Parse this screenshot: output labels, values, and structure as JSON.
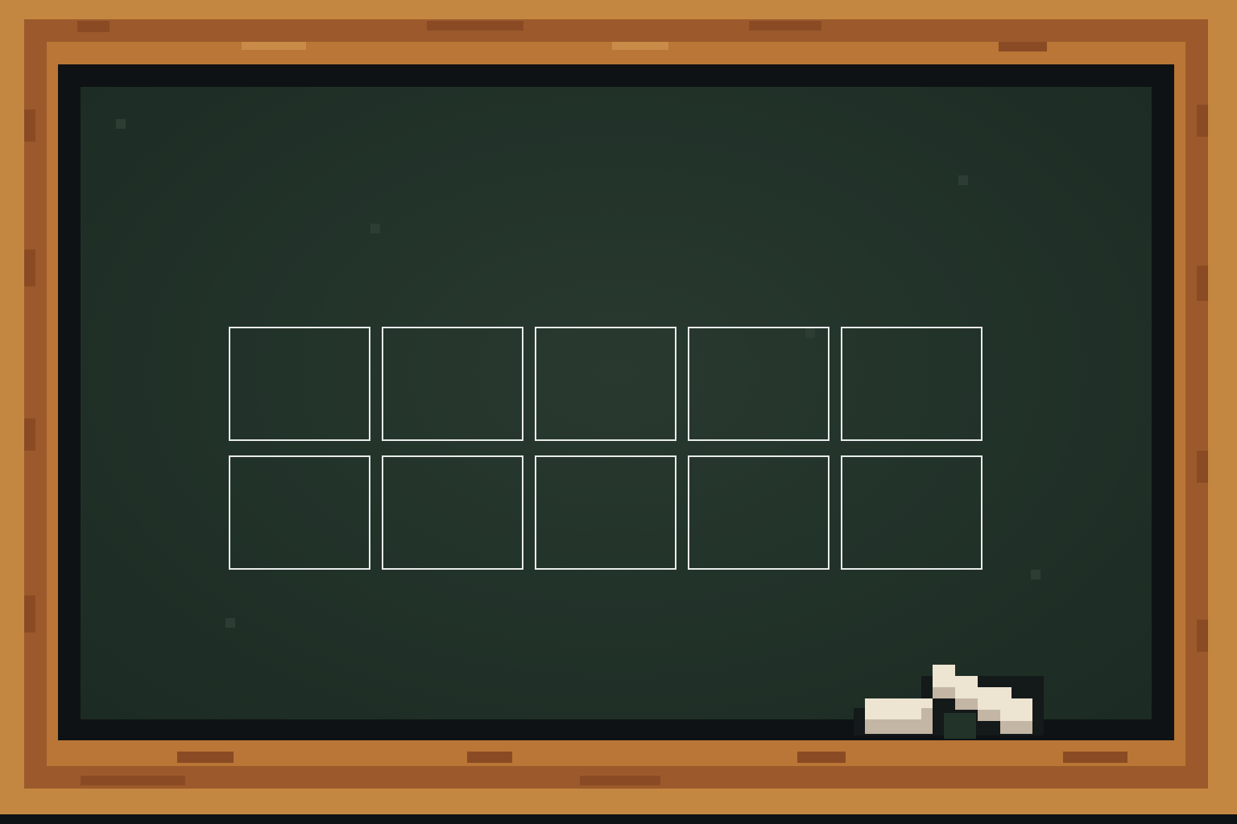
{
  "scene": {
    "type": "chalkboard-slot-grid",
    "colors": {
      "frame_light": "#c48741",
      "frame_dark": "#9c5a2c",
      "board": "#22332a",
      "slot_outline": "#e9ecea",
      "chalk": "#eee4d2"
    }
  },
  "grid": {
    "rows": 2,
    "columns": 5,
    "slots": [
      {
        "row": 1,
        "col": 1
      },
      {
        "row": 1,
        "col": 2
      },
      {
        "row": 1,
        "col": 3
      },
      {
        "row": 1,
        "col": 4
      },
      {
        "row": 1,
        "col": 5
      },
      {
        "row": 2,
        "col": 1
      },
      {
        "row": 2,
        "col": 2
      },
      {
        "row": 2,
        "col": 3
      },
      {
        "row": 2,
        "col": 4
      },
      {
        "row": 2,
        "col": 5
      }
    ]
  },
  "chalk": {
    "icon": "chalk-icon",
    "pieces": 2
  }
}
